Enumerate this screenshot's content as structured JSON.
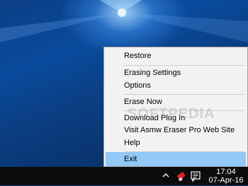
{
  "context_menu": {
    "items": [
      {
        "label": "Restore"
      },
      {
        "label": "Erasing Settings"
      },
      {
        "label": "Options"
      },
      {
        "label": "Erase Now"
      },
      {
        "label": "Download Plug In"
      },
      {
        "label": "Visit Asmw Eraser Pro Web Site"
      },
      {
        "label": "Help"
      },
      {
        "label": "Exit",
        "highlighted": true
      }
    ]
  },
  "watermark": "SOFTPEDIA",
  "taskbar": {
    "tray_icons": [
      "chevron-up-icon",
      "eraser-app-icon",
      "notification-icon"
    ],
    "clock_time": "17:04",
    "clock_date": "07-Apr-16"
  },
  "colors": {
    "menu_background": "#f2f2f2",
    "highlight": "#91c9f7",
    "taskbar": "#0c0c0c",
    "desktop": "#0a4a9c"
  }
}
